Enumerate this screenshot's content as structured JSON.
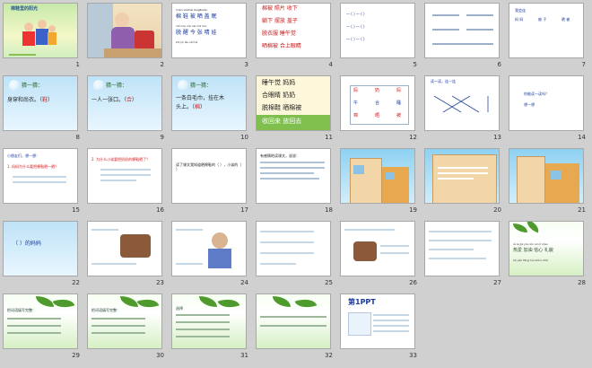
{
  "slides": [
    {
      "num": "1",
      "title": "棉鞋里的阳光"
    },
    {
      "num": "2"
    },
    {
      "num": "3",
      "pinyin": [
        "mián xiéshài bèigāiwán",
        "chù tou nǎi nai mā ma",
        "zhí jiǔ lǎo shì hé"
      ],
      "chars": [
        "棉 鞋 被 晒 盖 眠",
        "脱 醒 今 张 晴 娃"
      ]
    },
    {
      "num": "4",
      "rows": [
        "棉被 照片 收下",
        "躺下 摆放 盖子",
        "脱衣服 睡午觉",
        "晒棉被 合上眼睛"
      ]
    },
    {
      "num": "5",
      "rows": [
        "一 ( ) 一 ( )",
        "一 ( ) 一 ( )",
        "一 ( ) 一 ( )"
      ]
    },
    {
      "num": "6"
    },
    {
      "num": "7",
      "label": "我会连",
      "row1": [
        "妈 妈",
        "被 子",
        "晒 被"
      ]
    },
    {
      "num": "8",
      "title": "猜一猜：",
      "body": "身穿和尚衣。（",
      "ans": "鞋",
      "tail": "）"
    },
    {
      "num": "9",
      "title": "猜一猜：",
      "body": "一人一张口。（",
      "ans": "合",
      "tail": "）"
    },
    {
      "num": "10",
      "title": "猜一猜：",
      "body": "一条白毛巾，挂在木",
      "body2": "头上。（",
      "ans": "棉",
      "tail": "）"
    },
    {
      "num": "11",
      "rows": [
        "睡午觉 妈妈",
        "合眼睛 奶奶",
        "脱棉鞋 晒棉被",
        "收回来 放回去"
      ]
    },
    {
      "num": "12",
      "row1": [
        "妈",
        "奶",
        "妈"
      ],
      "row2": [
        "午",
        "合",
        "睡"
      ],
      "row3": [
        "棉",
        "晒",
        "被"
      ]
    },
    {
      "num": "13",
      "label": "读一读，连一连"
    },
    {
      "num": "14",
      "q": "你能读一读吗？",
      "q2": "想一想"
    },
    {
      "num": "15",
      "q": "小朋友们，想一想：",
      "q2": "1. 妈妈为什么要把棉鞋晒一晒？"
    },
    {
      "num": "16",
      "q": "2. 为什么小弟要把奶奶的棉鞋晒了？"
    },
    {
      "num": "17",
      "q": "读了课文我知道晒棉鞋的（ ），小弟的（ ）"
    },
    {
      "num": "18",
      "q": "有感情地读课文，说说："
    },
    {
      "num": "19"
    },
    {
      "num": "20"
    },
    {
      "num": "21"
    },
    {
      "num": "22",
      "label": "（ ）的妈妈"
    },
    {
      "num": "23"
    },
    {
      "num": "24"
    },
    {
      "num": "25"
    },
    {
      "num": "26"
    },
    {
      "num": "27"
    },
    {
      "num": "28",
      "pinyin": "rè ài jiā yóu xìn xin lǐ mào",
      "words": "热爱 加油 信心 礼貌",
      "line2": "hé yán fāng huì shǒu chǎi"
    },
    {
      "num": "29",
      "label": "把词语填写完整："
    },
    {
      "num": "30",
      "label": "把词语填写完整："
    },
    {
      "num": "31",
      "label": "选择"
    },
    {
      "num": "32"
    },
    {
      "num": "33",
      "brand": "第1PPT"
    }
  ]
}
